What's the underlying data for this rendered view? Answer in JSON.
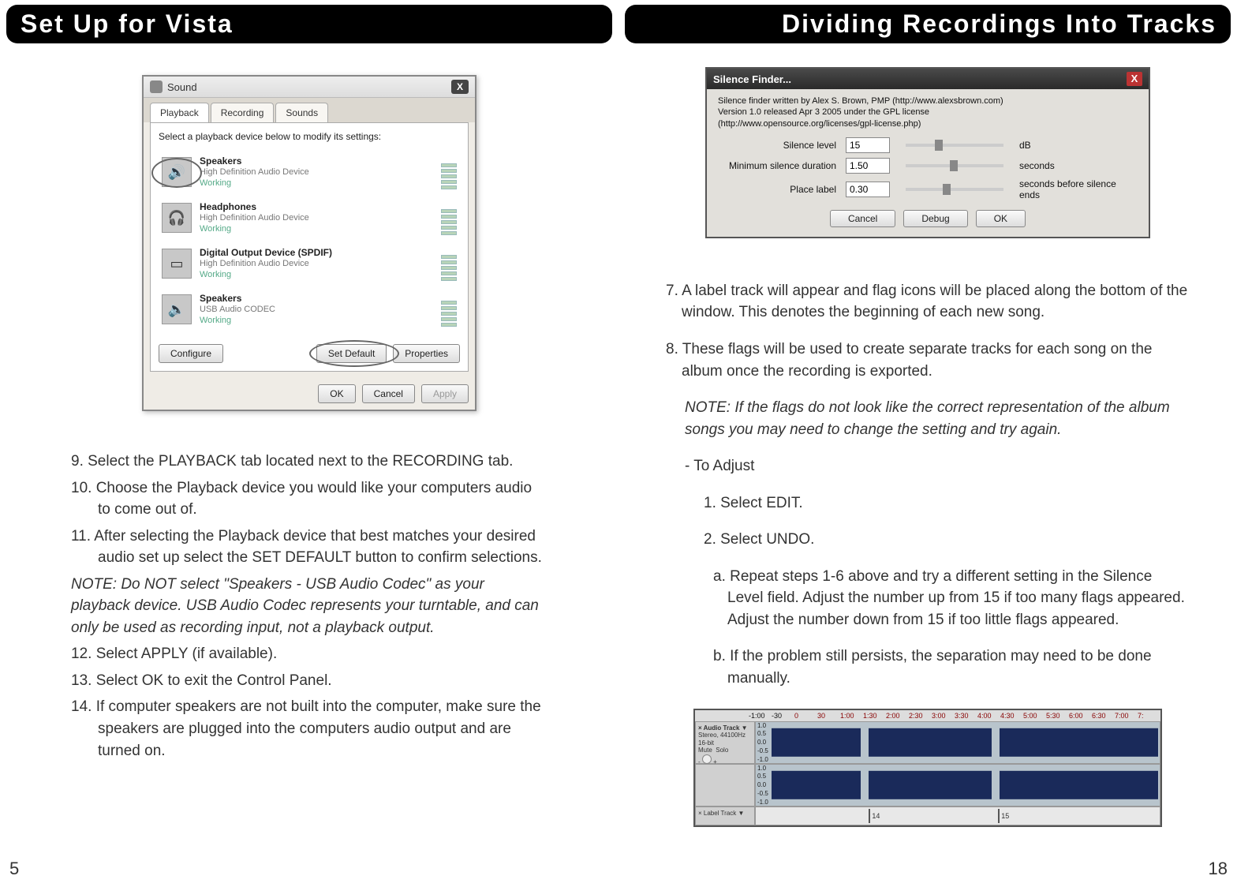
{
  "left": {
    "header": "Set Up for Vista",
    "sound_dialog": {
      "title": "Sound",
      "tabs": [
        "Playback",
        "Recording",
        "Sounds"
      ],
      "caption": "Select a playback device below to modify its settings:",
      "devices": [
        {
          "name": "Speakers",
          "desc": "High Definition Audio Device",
          "status": "Working",
          "circled": true
        },
        {
          "name": "Headphones",
          "desc": "High Definition Audio Device",
          "status": "Working",
          "circled": false
        },
        {
          "name": "Digital Output Device (SPDIF)",
          "desc": "High Definition Audio Device",
          "status": "Working",
          "circled": false
        },
        {
          "name": "Speakers",
          "desc": "USB Audio CODEC",
          "status": "Working",
          "circled": false
        }
      ],
      "buttons": {
        "configure": "Configure",
        "set_default": "Set Default",
        "properties": "Properties",
        "ok": "OK",
        "cancel": "Cancel",
        "apply": "Apply"
      }
    },
    "steps_a": [
      " 9. Select the PLAYBACK tab located next to the RECORDING tab.",
      "10. Choose the Playback device you would like your computers audio to come out of.",
      "11. After selecting the Playback device that best matches your desired audio set up select the SET DEFAULT button to confirm selections."
    ],
    "note": "NOTE: Do NOT select \"Speakers - USB Audio Codec\" as your playback device. USB Audio Codec represents your turntable, and can only be used as recording input, not a playback output.",
    "steps_b": [
      "12. Select APPLY (if available).",
      "13. Select OK to exit the Control Panel.",
      "14. If computer speakers are not built into the computer, make sure the speakers are plugged into the computers audio output and are turned on."
    ],
    "page_num": "5"
  },
  "right": {
    "header": "Dividing Recordings Into Tracks",
    "silence": {
      "title": "Silence Finder...",
      "info1": "Silence finder written by Alex S. Brown, PMP (http://www.alexsbrown.com)",
      "info2": "Version 1.0 released Apr 3 2005 under the GPL license",
      "info3": "(http://www.opensource.org/licenses/gpl-license.php)",
      "rows": {
        "r1": {
          "label": "Silence level",
          "val": "15",
          "unit": "dB",
          "pos": 30
        },
        "r2": {
          "label": "Minimum silence duration",
          "val": "1.50",
          "unit": "seconds",
          "pos": 45
        },
        "r3": {
          "label": "Place label",
          "val": "0.30",
          "unit": "seconds before silence ends",
          "pos": 38
        }
      },
      "buttons": {
        "cancel": "Cancel",
        "debug": "Debug",
        "ok": "OK"
      }
    },
    "steps_a": [
      "7. A label track will appear and flag icons will be placed along the bottom of the window. This denotes the beginning of each new song.",
      "8. These flags will be used to create separate tracks for each song on the album once the recording is exported."
    ],
    "note": "NOTE: If the flags do not look like the correct representation of the album songs you may need to change the setting and try again.",
    "adjust_header": "- To Adjust",
    "adjust_1": "1. Select EDIT.",
    "adjust_2": "2. Select UNDO.",
    "adjust_a": "a. Repeat steps 1-6 above and try a different setting in the Silence Level field. Adjust the number up from 15 if too many flags appeared. Adjust the number down from 15 if too little flags appeared.",
    "adjust_b": "b. If the problem still persists, the separation may need to be done manually.",
    "audacity": {
      "ruler": [
        "-1:00",
        "-30",
        "0",
        "30",
        "1:00",
        "1:30",
        "2:00",
        "2:30",
        "3:00",
        "3:30",
        "4:00",
        "4:30",
        "5:00",
        "5:30",
        "6:00",
        "6:30",
        "7:00",
        "7:"
      ],
      "track_title": "Audio Track",
      "track_info": "Stereo, 44100Hz",
      "bit": "16-bit",
      "mute": "Mute",
      "solo": "Solo",
      "scale": [
        "1.0",
        "0.5",
        "0.0",
        "-0.5",
        "-1.0"
      ],
      "label_title": "Label Track",
      "flag1": "14",
      "flag2": "15"
    },
    "page_num": "18"
  }
}
